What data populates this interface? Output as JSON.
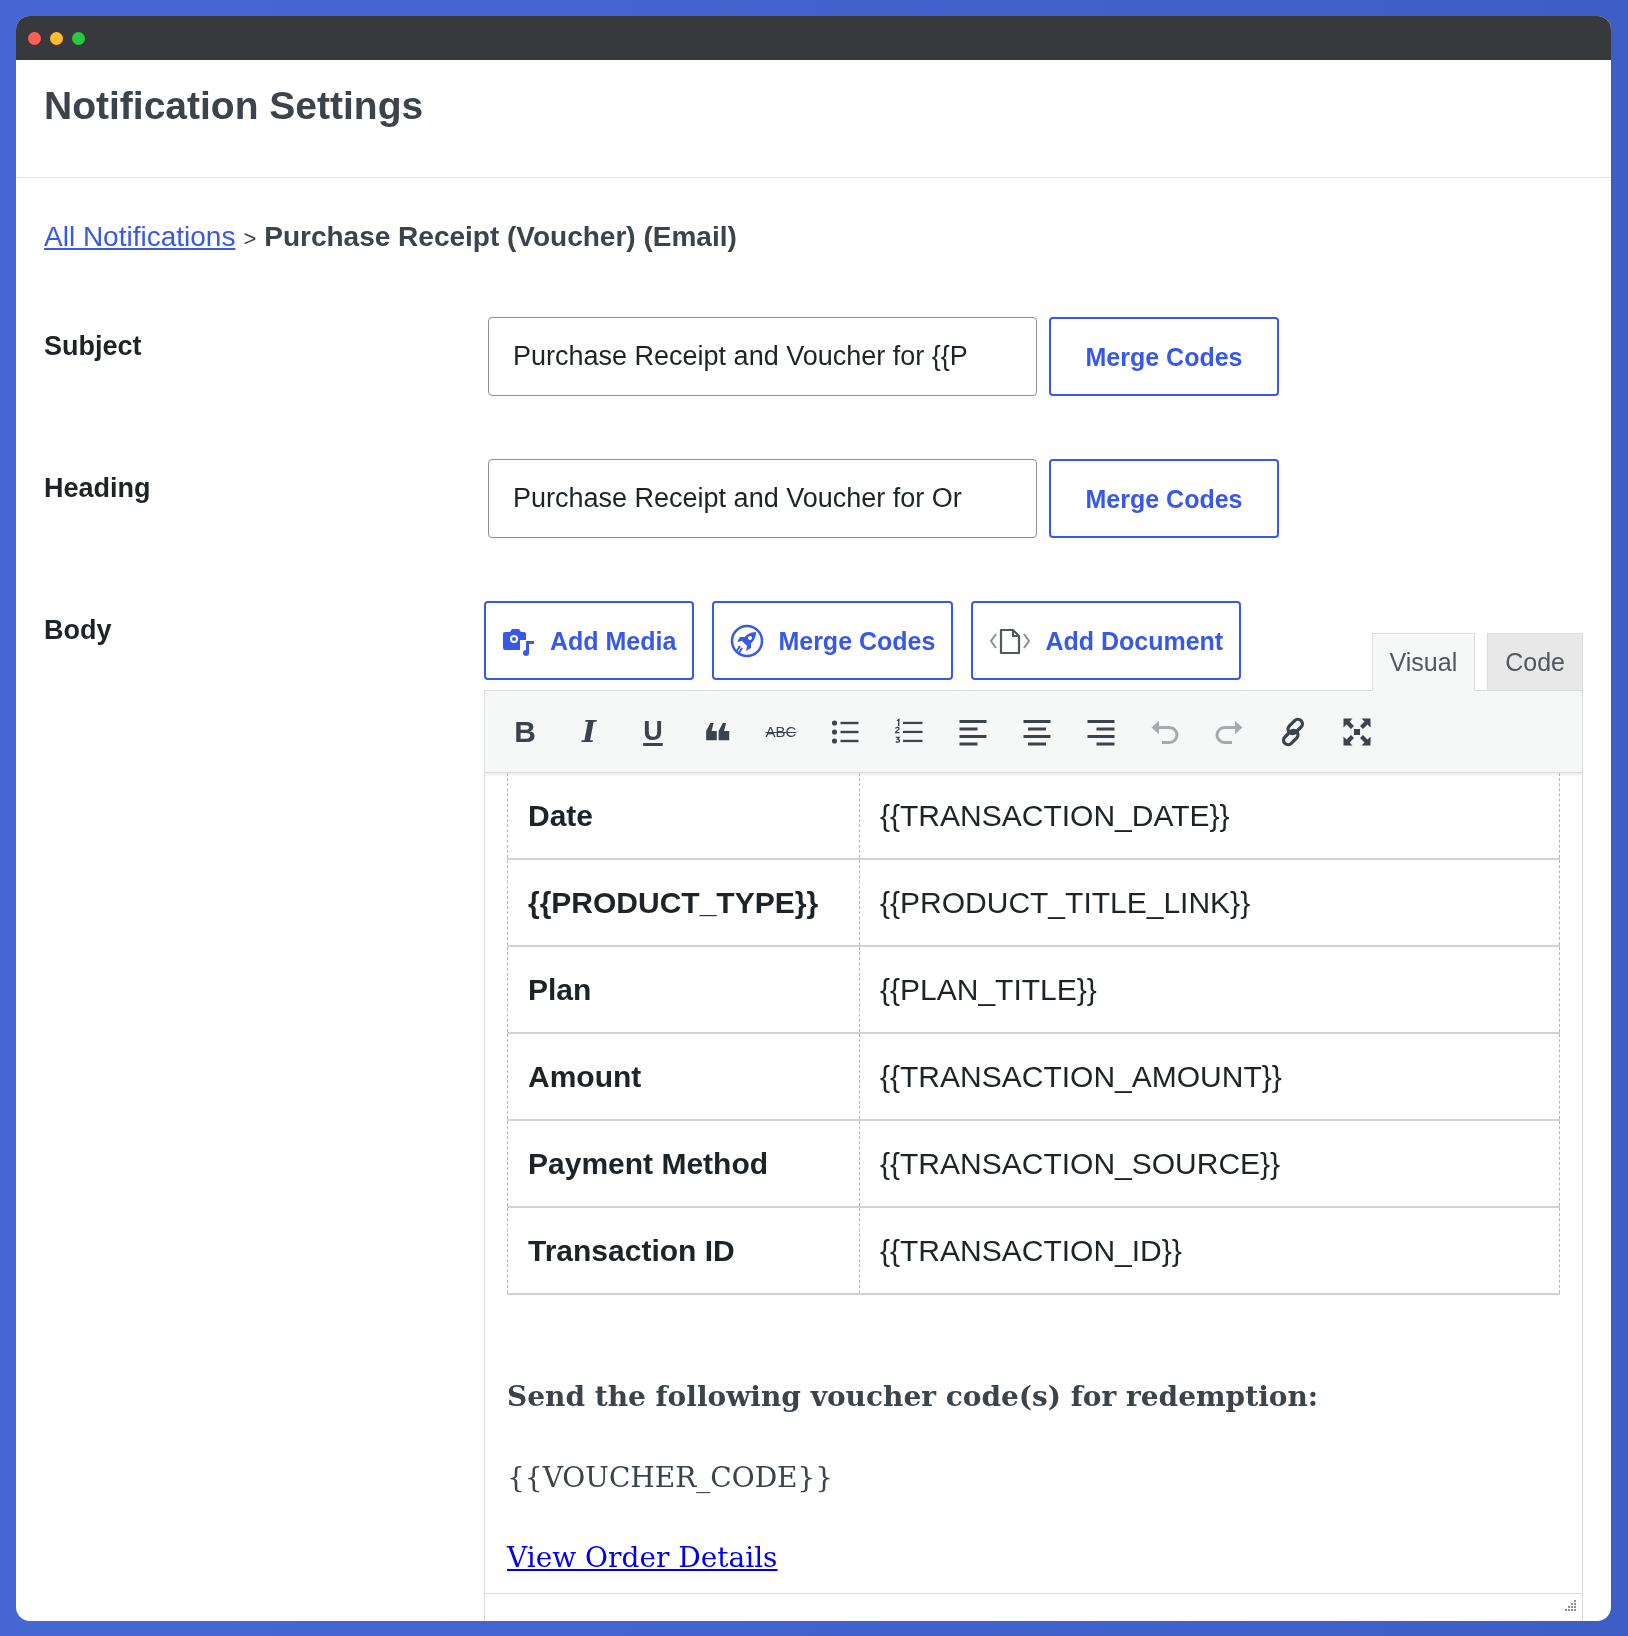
{
  "page_title": "Notification Settings",
  "breadcrumb": {
    "link": "All Notifications",
    "separator": ">",
    "current": "Purchase Receipt (Voucher) (Email)"
  },
  "fields": [
    {
      "label": "Subject",
      "value": "Purchase Receipt and Voucher for {{P",
      "button": "Merge Codes"
    },
    {
      "label": "Heading",
      "value": "Purchase Receipt and Voucher for Or",
      "button": "Merge Codes"
    }
  ],
  "body": {
    "label": "Body",
    "buttons": [
      {
        "kind": "media",
        "label": "Add Media"
      },
      {
        "kind": "merge",
        "label": "Merge Codes"
      },
      {
        "kind": "document",
        "label": "Add Document"
      }
    ],
    "tabs": [
      {
        "label": "Visual",
        "selected": true
      },
      {
        "label": "Code",
        "selected": false
      }
    ],
    "toolbar": [
      {
        "kind": "bold",
        "glyph": "B",
        "disabled": false
      },
      {
        "kind": "italic",
        "glyph": "I",
        "disabled": false
      },
      {
        "kind": "underline",
        "glyph": "U",
        "disabled": false
      },
      {
        "kind": "blockquote",
        "glyph": "❝",
        "disabled": false
      },
      {
        "kind": "strikethrough",
        "glyph": "ABC",
        "disabled": false
      },
      {
        "kind": "bullet_list",
        "disabled": false
      },
      {
        "kind": "numbered_list",
        "disabled": false
      },
      {
        "kind": "align_left",
        "disabled": false
      },
      {
        "kind": "align_center",
        "disabled": false
      },
      {
        "kind": "align_right",
        "disabled": false
      },
      {
        "kind": "undo",
        "disabled": true
      },
      {
        "kind": "redo",
        "disabled": true
      },
      {
        "kind": "link",
        "disabled": false
      },
      {
        "kind": "fullscreen",
        "disabled": false
      }
    ],
    "content": {
      "rows": [
        {
          "label": "Date",
          "value": "{{TRANSACTION_DATE}}"
        },
        {
          "label": "{{PRODUCT_TYPE}}",
          "value": "{{PRODUCT_TITLE_LINK}}"
        },
        {
          "label": "Plan",
          "value": "{{PLAN_TITLE}}"
        },
        {
          "label": "Amount",
          "value": "{{TRANSACTION_AMOUNT}}"
        },
        {
          "label": "Payment Method",
          "value": "{{TRANSACTION_SOURCE}}"
        },
        {
          "label": "Transaction ID",
          "value": "{{TRANSACTION_ID}}"
        }
      ],
      "heading": "Send the following voucher code(s) for redemption:",
      "code": "{{VOUCHER_CODE}}",
      "link": "View Order Details"
    }
  }
}
